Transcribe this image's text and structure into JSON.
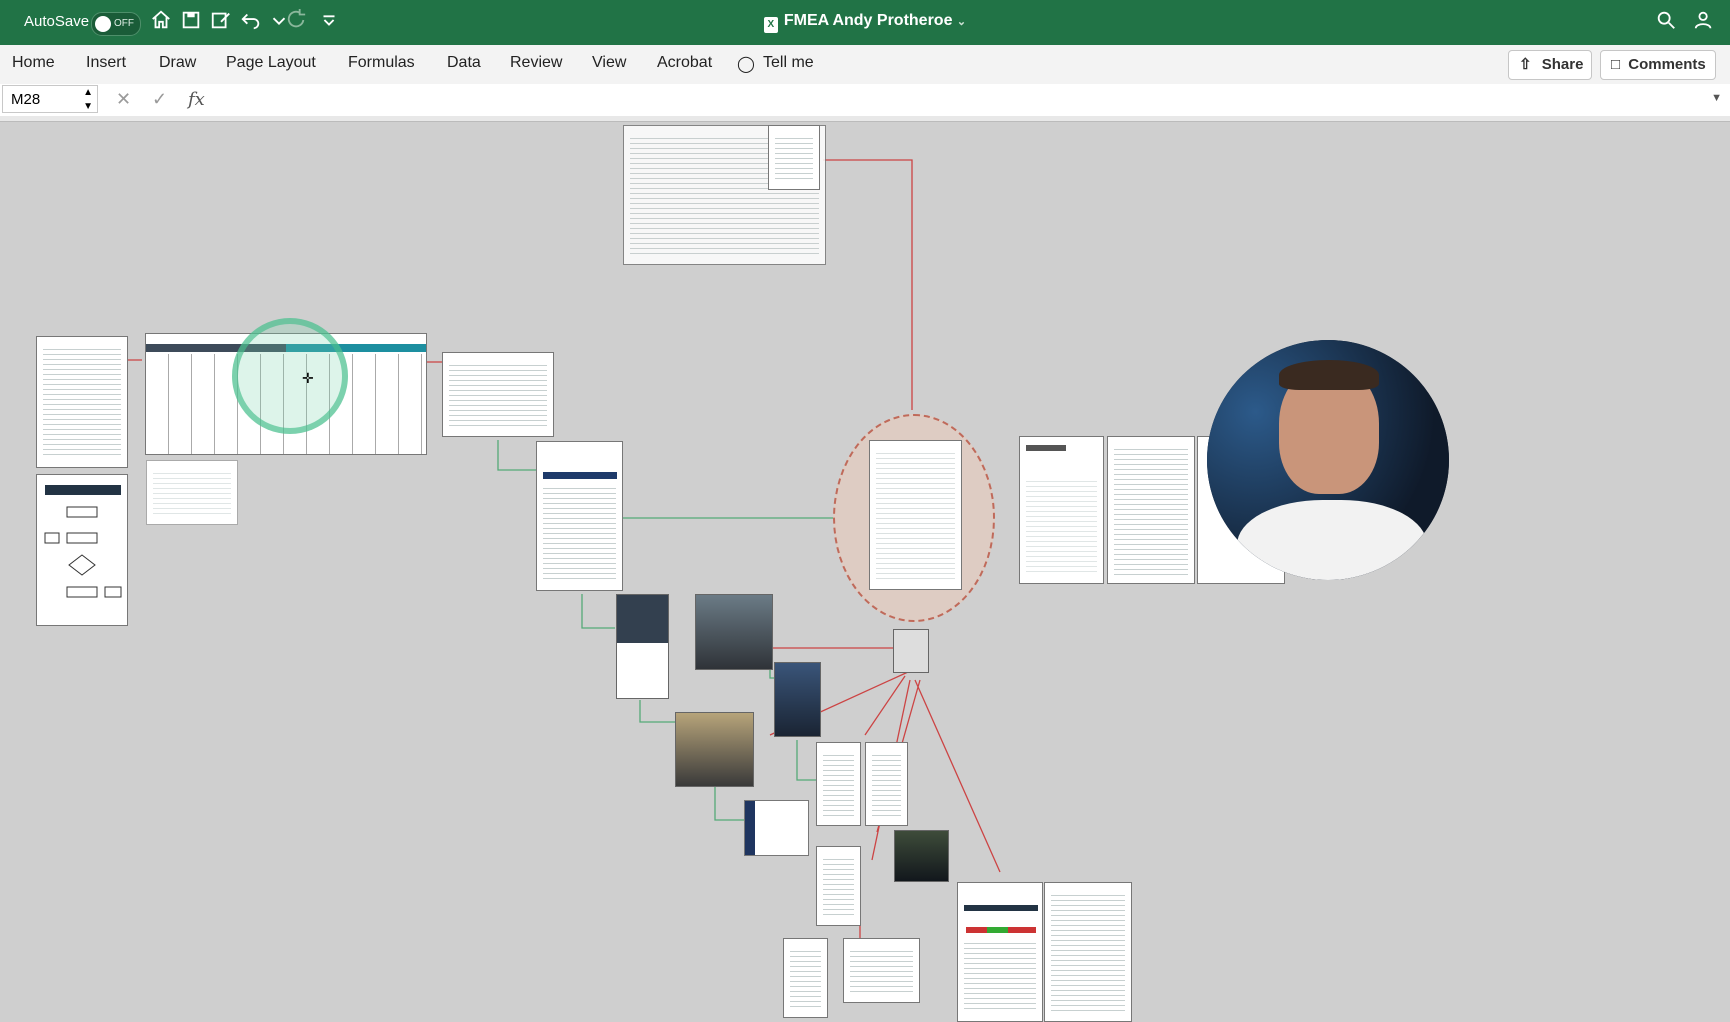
{
  "title_bar": {
    "autosave_label": "AutoSave",
    "autosave_state": "OFF",
    "document_title": "FMEA Andy Protheroe",
    "brand_color": "#217346"
  },
  "ribbon": {
    "tabs": [
      "Home",
      "Insert",
      "Draw",
      "Page Layout",
      "Formulas",
      "Data",
      "Review",
      "View",
      "Acrobat"
    ],
    "tell_me": "Tell me",
    "share_label": "Share",
    "comments_label": "Comments"
  },
  "formula_bar": {
    "cell_reference": "M28",
    "fx_label": "fx",
    "formula_value": ""
  },
  "canvas": {
    "image_documents": [
      "flowchart-diagram",
      "fmea-worksheet",
      "policy-statement",
      "international-standard",
      "site-report",
      "training-certificate",
      "group-photo",
      "meeting-photo",
      "webcam-presenter"
    ]
  }
}
